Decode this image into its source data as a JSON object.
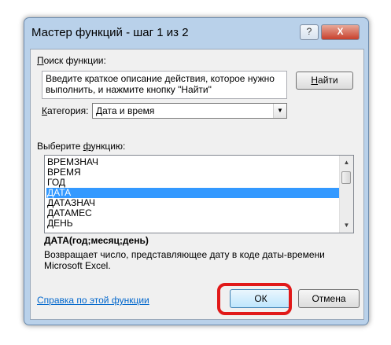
{
  "window": {
    "title": "Мастер функций - шаг 1 из 2",
    "help_glyph": "?",
    "close_glyph": "X"
  },
  "search": {
    "label_accel": "П",
    "label_rest": "оиск функции:",
    "description": "Введите краткое описание действия, которое нужно выполнить, и нажмите кнопку \"Найти\"",
    "find_accel": "Н",
    "find_rest": "айти"
  },
  "category": {
    "label_accel": "К",
    "label_rest": "атегория:",
    "selected": "Дата и время"
  },
  "function_list": {
    "label_before": "Выберите ",
    "label_accel": "ф",
    "label_after": "ункцию:",
    "items": [
      {
        "name": "ВРЕМЗНАЧ"
      },
      {
        "name": "ВРЕМЯ"
      },
      {
        "name": "ГОД"
      },
      {
        "name": "ДАТА"
      },
      {
        "name": "ДАТАЗНАЧ"
      },
      {
        "name": "ДАТАМЕС"
      },
      {
        "name": "ДЕНЬ"
      }
    ],
    "selected_index": 3
  },
  "selected_function": {
    "signature": "ДАТА(год;месяц;день)",
    "description": "Возвращает число, представляющее дату в коде даты-времени Microsoft Excel."
  },
  "footer": {
    "help_link": "Справка по этой функции",
    "ok_label": "ОК",
    "cancel_label": "Отмена"
  },
  "colors": {
    "accent_selected": "#3399ff",
    "highlight_ring": "#e11919",
    "link": "#0066cc"
  }
}
